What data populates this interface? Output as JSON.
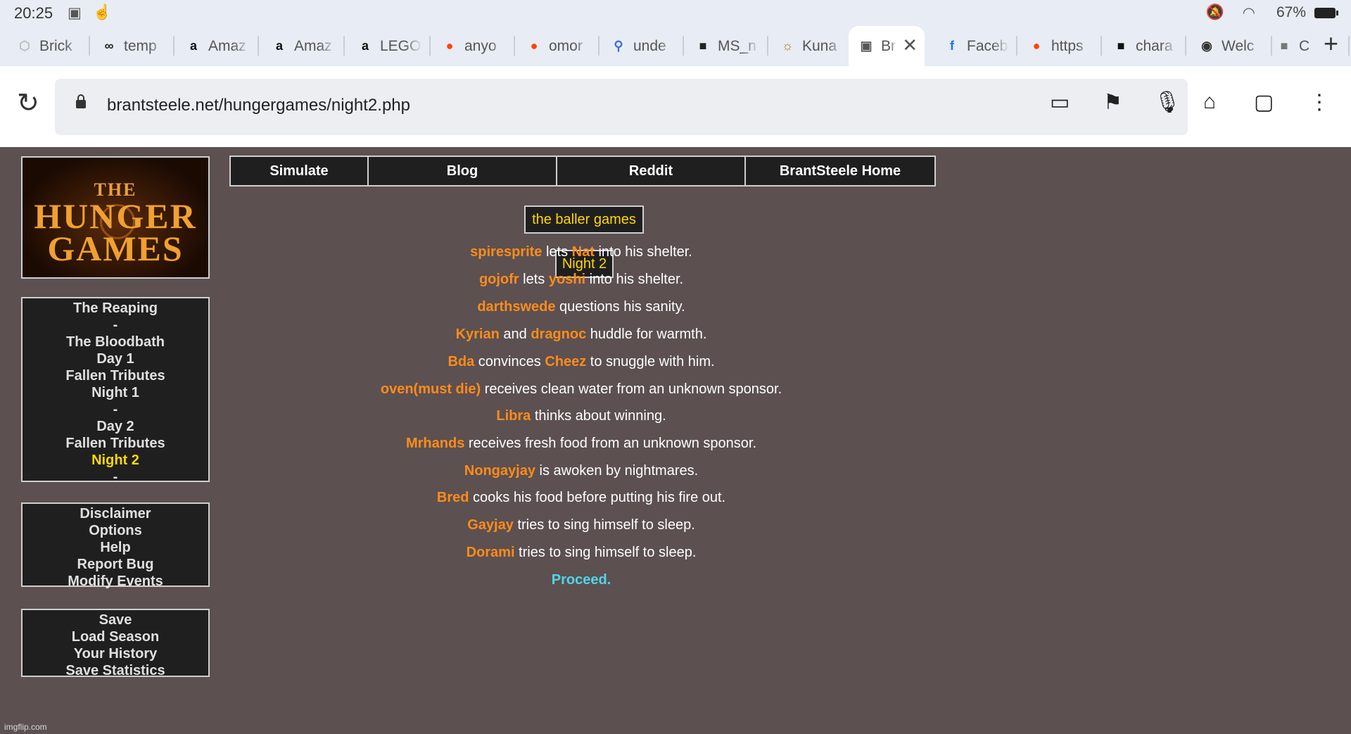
{
  "status_bar": {
    "time": "20:25",
    "battery": "67%"
  },
  "tabs": [
    {
      "label": "Brick",
      "favicon": "brick-favicon",
      "color": "#bbbbbb"
    },
    {
      "label": "temp",
      "favicon": "infinity-favicon",
      "color": "#222222"
    },
    {
      "label": "Amaz",
      "favicon": "amazon-favicon",
      "color": "#111111"
    },
    {
      "label": "Amaz",
      "favicon": "amazon-favicon",
      "color": "#111111"
    },
    {
      "label": "LEGO",
      "favicon": "amazon-favicon",
      "color": "#111111"
    },
    {
      "label": "anyo",
      "favicon": "reddit-favicon",
      "color": "#ff4500"
    },
    {
      "label": "omor",
      "favicon": "reddit-favicon",
      "color": "#ff4500"
    },
    {
      "label": "unde",
      "favicon": "search-favicon",
      "color": "#3d6fd1"
    },
    {
      "label": "MS_n",
      "favicon": "ms-favicon",
      "color": "#222222"
    },
    {
      "label": "Kuna",
      "favicon": "kuna-favicon",
      "color": "#9a7a20"
    },
    {
      "label": "Bra",
      "favicon": "brantsteele-favicon",
      "color": "#555555",
      "active": true
    },
    {
      "label": "Faceb",
      "favicon": "facebook-favicon",
      "color": "#1877f2"
    },
    {
      "label": "https",
      "favicon": "reddit-favicon",
      "color": "#ff4500"
    },
    {
      "label": "chara",
      "favicon": "characterai-favicon",
      "color": "#111111"
    },
    {
      "label": "Welc",
      "favicon": "globe-favicon",
      "color": "#333333"
    },
    {
      "label": "C",
      "favicon": "characterai-favicon",
      "color": "#777777"
    }
  ],
  "omnibox": {
    "url": "brantsteele.net/hungergames/night2.php"
  },
  "logo": {
    "line1": "THE",
    "line2": "HUNGER",
    "line3": "GAMES"
  },
  "topnav": [
    "Simulate",
    "Blog",
    "Reddit",
    "BrantSteele Home"
  ],
  "nav": {
    "items": [
      "The Reaping",
      "-",
      "The Bloodbath",
      "Day 1",
      "Fallen Tributes",
      "Night 1",
      "-",
      "Day 2",
      "Fallen Tributes",
      "Night 2",
      "-"
    ],
    "current": "Night 2"
  },
  "menu1": [
    "Disclaimer",
    "Options",
    "Help",
    "Report Bug",
    "Modify Events"
  ],
  "menu2": [
    "Save",
    "Load Season",
    "Your History",
    "Save Statistics"
  ],
  "game_title": "the baller games",
  "day_title": "Night 2",
  "events": [
    [
      {
        "t": "spiresprite",
        "n": true
      },
      {
        "t": " lets "
      },
      {
        "t": "Nat",
        "n": true
      },
      {
        "t": " into his shelter."
      }
    ],
    [
      {
        "t": "gojofr",
        "n": true
      },
      {
        "t": " lets "
      },
      {
        "t": "yoshi",
        "n": true
      },
      {
        "t": " into his shelter."
      }
    ],
    [
      {
        "t": "darthswede",
        "n": true
      },
      {
        "t": " questions his sanity."
      }
    ],
    [
      {
        "t": "Kyrian",
        "n": true
      },
      {
        "t": " and "
      },
      {
        "t": "dragnoc",
        "n": true
      },
      {
        "t": " huddle for warmth."
      }
    ],
    [
      {
        "t": "Bda",
        "n": true
      },
      {
        "t": " convinces "
      },
      {
        "t": "Cheez",
        "n": true
      },
      {
        "t": " to snuggle with him."
      }
    ],
    [
      {
        "t": "oven(must die)",
        "n": true
      },
      {
        "t": " receives clean water from an unknown sponsor."
      }
    ],
    [
      {
        "t": "Libra",
        "n": true
      },
      {
        "t": " thinks about winning."
      }
    ],
    [
      {
        "t": "Mrhands",
        "n": true
      },
      {
        "t": " receives fresh food from an unknown sponsor."
      }
    ],
    [
      {
        "t": "Nongayjay",
        "n": true
      },
      {
        "t": " is awoken by nightmares."
      }
    ],
    [
      {
        "t": "Bred",
        "n": true
      },
      {
        "t": " cooks his food before putting his fire out."
      }
    ],
    [
      {
        "t": "Gayjay",
        "n": true
      },
      {
        "t": " tries to sing himself to sleep."
      }
    ],
    [
      {
        "t": "Dorami",
        "n": true
      },
      {
        "t": " tries to sing himself to sleep."
      }
    ]
  ],
  "proceed": "Proceed.",
  "watermark": "imgflip.com",
  "colors": {
    "page_bg": "#5c5051",
    "name": "#ff8c1a",
    "highlight": "#ffd800",
    "proceed": "#4fd7e8"
  }
}
